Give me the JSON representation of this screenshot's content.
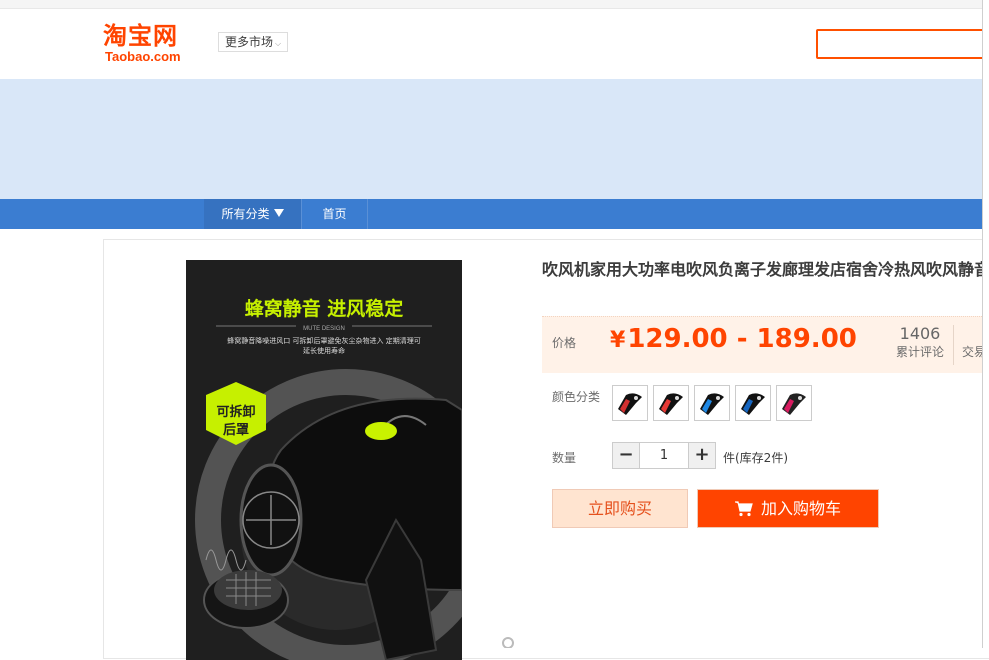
{
  "header": {
    "logo_zh": "淘宝网",
    "logo_en": "Taobao.com",
    "market_label": "更多市场",
    "search_placeholder": ""
  },
  "nav": {
    "all_categories": "所有分类",
    "home": "首页"
  },
  "product": {
    "title": "吹风机家用大功率电吹风负离子发廊理发店宿舍冷热风吹风静音",
    "image_text": {
      "headline": "蜂窝静音 进风稳定",
      "sub_en": "MUTE DESIGN",
      "desc": "蜂窝静音降噪进风口 可拆卸后罩避免灰尘杂物进入 定期清理可延长使用寿命",
      "badge_line1": "可拆卸",
      "badge_line2": "后罩"
    },
    "price_label": "价格",
    "currency": "¥",
    "price": "129.00 - 189.00",
    "reviews_count": "1406",
    "reviews_label": "累计评论",
    "transactions_label": "交易",
    "color_label": "颜色分类",
    "swatch_colors": [
      "#d32f2f",
      "#e53935",
      "#1e88e5",
      "#1565c0",
      "#d81b60"
    ],
    "qty_label": "数量",
    "qty_minus": "−",
    "qty_value": "1",
    "qty_plus": "+",
    "stock_text": "件(库存2件)",
    "buy_now": "立即购买",
    "add_to_cart": "加入购物车"
  },
  "colors": {
    "brand": "#ff4400",
    "nav_bg": "#3b7dd1",
    "banner_bg": "#d9e7f8"
  }
}
